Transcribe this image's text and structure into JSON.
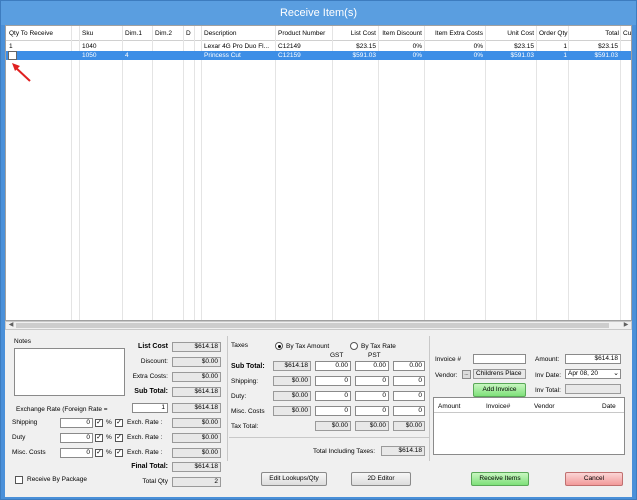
{
  "window": {
    "title": "Receive Item(s)"
  },
  "grid": {
    "columns": [
      "Qty To Receive",
      "",
      "Sku",
      "Dim.1",
      "Dim.2",
      "D",
      "Description",
      "Product Number",
      "List Cost",
      "Item Discount",
      "Item Extra Costs",
      "Unit Cost",
      "Order Qty",
      "Total",
      "Cu"
    ],
    "rows": [
      {
        "qty": "1",
        "sku": "1040",
        "dim1": "",
        "dim2": "",
        "description": "Lexar 4G Pro Duo Fl...",
        "product_number": "C12149",
        "list_cost": "$23.15",
        "item_discount": "0%",
        "item_extra_costs": "0%",
        "unit_cost": "$23.15",
        "order_qty": "1",
        "total": "$23.15"
      },
      {
        "qty": "",
        "sku": "1050",
        "dim1": "4",
        "dim2": "",
        "description": "Princess Cut",
        "product_number": "C12159",
        "list_cost": "$591.03",
        "item_discount": "0%",
        "item_extra_costs": "0%",
        "unit_cost": "$591.03",
        "order_qty": "1",
        "total": "$591.03"
      }
    ]
  },
  "notes": {
    "label": "Notes"
  },
  "costs": {
    "list_cost_label": "List Cost",
    "list_cost": "$614.18",
    "discount_label": "Discount:",
    "discount": "$0.00",
    "extra_costs_label": "Extra Costs:",
    "extra_costs": "$0.00",
    "sub_total_label": "Sub Total:",
    "sub_total": "$614.18",
    "exchange_rate_label": "Exchange Rate  (Foreign  Rate =",
    "exchange_rate_value": "1",
    "exchange_total": "$614.18",
    "shipping_label": "Shipping",
    "shipping_value": "0",
    "shipping_exch": "$0.00",
    "duty_label": "Duty",
    "duty_value": "0",
    "duty_exch": "$0.00",
    "misc_label": "Misc. Costs",
    "misc_value": "0",
    "misc_exch": "$0.00",
    "percent": "%",
    "exch_rate_label": "Exch. Rate :",
    "final_total_label": "Final Total:",
    "final_total": "$614.18",
    "total_qty_label": "Total Qty",
    "total_qty": "2",
    "receive_by_package_label": "Receive By Package"
  },
  "taxes": {
    "label": "Taxes",
    "by_tax_amount": "By Tax Amount",
    "by_tax_rate": "By Tax Rate",
    "gst": "GST",
    "pst": "PST",
    "sub_total_label": "Sub Total:",
    "sub_total": "$614.18",
    "sub_gst": "0.00",
    "sub_pst": "0.00",
    "sub_extra": "0.00",
    "shipping_label": "Shipping:",
    "shipping": "$0.00",
    "ship_gst": "0",
    "ship_pst": "0",
    "ship_extra": "0",
    "duty_label": "Duty:",
    "duty": "$0.00",
    "duty_gst": "0",
    "duty_pst": "0",
    "duty_extra": "0",
    "misc_label": "Misc. Costs",
    "misc": "$0.00",
    "misc_gst": "0",
    "misc_pst": "0",
    "misc_extra": "0",
    "tax_total_label": "Tax Total:",
    "tax_gst": "$0.00",
    "tax_pst": "$0.00",
    "tax_extra": "$0.00",
    "total_incl_label": "Total Including Taxes:",
    "total_incl": "$614.18"
  },
  "invoice": {
    "invoice_label": "Invoice #",
    "invoice_value": "",
    "amount_label": "Amount:",
    "amount": "$614.18",
    "vendor_label": "Vendor:",
    "vendor": "Childrens Place",
    "inv_date_label": "Inv Date:",
    "inv_date": "Apr 08, 20",
    "add_invoice": "Add Invoice",
    "inv_total_label": "Inv Total:",
    "inv_total": "",
    "list_headers": [
      "Amount",
      "Invoice#",
      "Vendor",
      "Date"
    ]
  },
  "buttons": {
    "edit_lookups": "Edit Lookups/Qty",
    "editor_2d": "2D Editor",
    "receive_items": "Receive Items",
    "cancel": "Cancel"
  },
  "colors": {
    "title": "#5a9ee0",
    "selection": "#3d8ee6",
    "accent_green": "#7fe07a",
    "accent_red": "#f29a9a"
  }
}
